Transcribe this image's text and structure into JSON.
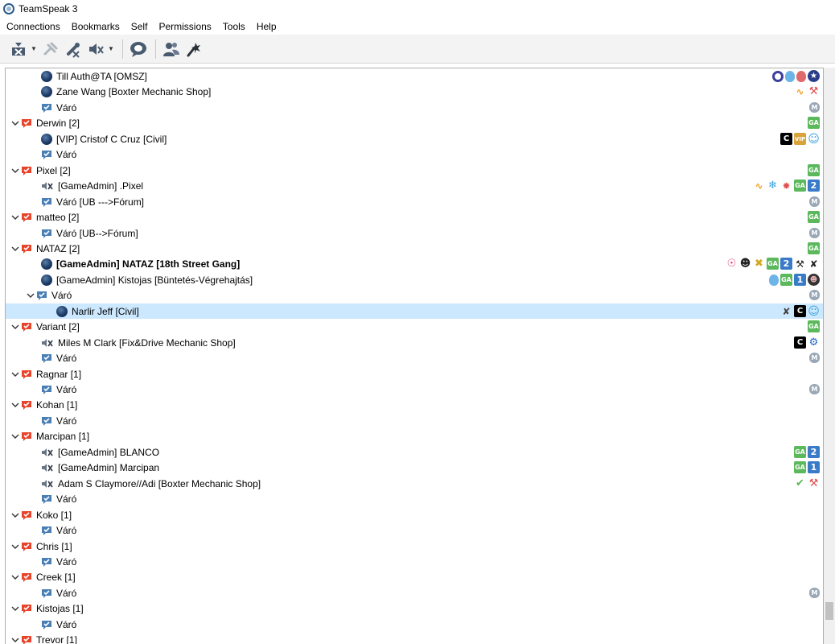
{
  "window": {
    "title": "TeamSpeak 3"
  },
  "menu": [
    "Connections",
    "Bookmarks",
    "Self",
    "Permissions",
    "Tools",
    "Help"
  ],
  "toolbar": [
    {
      "name": "disconnect",
      "icon": "disconnect-icon"
    },
    {
      "name": "connect",
      "icon": "link-icon"
    },
    {
      "name": "mute-microphone",
      "icon": "mic-mute-icon"
    },
    {
      "name": "mute-speakers",
      "icon": "speaker-mute-icon"
    },
    {
      "name": "away",
      "icon": "chat-bubble-icon"
    },
    {
      "name": "contacts",
      "icon": "users-icon"
    },
    {
      "name": "plugins",
      "icon": "wand-icon"
    }
  ],
  "tree": [
    {
      "level": 2,
      "type": "user",
      "label": "Till Auth@TA [OMSZ]",
      "right": [
        "ring-blue",
        "egg-blue",
        "egg-red",
        "star-badge"
      ]
    },
    {
      "level": 2,
      "type": "user",
      "label": "Zane Wang [Boxter Mechanic Shop]",
      "right": [
        "wave",
        "wrench"
      ]
    },
    {
      "level": 2,
      "type": "channel",
      "label": "Váró",
      "right": [
        "m"
      ]
    },
    {
      "level": 1,
      "type": "channel-group",
      "label": "Derwin [2]",
      "expanded": true,
      "right": [
        "ga"
      ]
    },
    {
      "level": 2,
      "type": "user",
      "label": "[VIP] Cristof C Cruz [Civil]",
      "right": [
        "c",
        "vip",
        "person"
      ]
    },
    {
      "level": 2,
      "type": "channel",
      "label": "Váró",
      "right": []
    },
    {
      "level": 1,
      "type": "channel-group",
      "label": "Pixel [2]",
      "expanded": true,
      "right": [
        "ga"
      ]
    },
    {
      "level": 2,
      "type": "user-muted",
      "label": "[GameAdmin] .Pixel",
      "right": [
        "wave",
        "snow",
        "burst",
        "ga",
        "num2"
      ]
    },
    {
      "level": 2,
      "type": "channel",
      "label": "Váró [UB --->Fórum]",
      "right": [
        "m"
      ]
    },
    {
      "level": 1,
      "type": "channel-group",
      "label": "matteo [2]",
      "expanded": true,
      "right": [
        "ga"
      ]
    },
    {
      "level": 2,
      "type": "channel",
      "label": "Váró [UB-->Fórum]",
      "right": [
        "m"
      ]
    },
    {
      "level": 1,
      "type": "channel-group",
      "label": "NATAZ [2]",
      "expanded": true,
      "right": [
        "ga"
      ]
    },
    {
      "level": 2,
      "type": "user",
      "label": "[GameAdmin] NATAZ [18th Street Gang]",
      "bold": true,
      "right": [
        "headset",
        "mask",
        "cross",
        "ga",
        "num2",
        "tool",
        "dancer"
      ]
    },
    {
      "level": 2,
      "type": "user",
      "label": "[GameAdmin] Kistojas [Büntetés-Végrehajtás]",
      "right": [
        "egg-blue",
        "ga",
        "num1",
        "angry"
      ]
    },
    {
      "level": 2,
      "type": "channel",
      "label": "Váró",
      "expanded": true,
      "right": [
        "m"
      ]
    },
    {
      "level": 3,
      "type": "user",
      "label": "Narlir Jeff [Civil]",
      "selected": true,
      "right": [
        "mic-cross",
        "c",
        "person"
      ]
    },
    {
      "level": 1,
      "type": "channel-group",
      "label": "Variant [2]",
      "expanded": true,
      "right": [
        "ga"
      ]
    },
    {
      "level": 2,
      "type": "user-muted",
      "label": "Miles M Clark [Fix&Drive Mechanic Shop]",
      "right": [
        "c",
        "gear"
      ]
    },
    {
      "level": 2,
      "type": "channel",
      "label": "Váró",
      "right": [
        "m"
      ]
    },
    {
      "level": 1,
      "type": "channel-group",
      "label": "Ragnar [1]",
      "expanded": true,
      "right": []
    },
    {
      "level": 2,
      "type": "channel",
      "label": "Váró",
      "right": [
        "m"
      ]
    },
    {
      "level": 1,
      "type": "channel-group",
      "label": "Kohan [1]",
      "expanded": true,
      "right": []
    },
    {
      "level": 2,
      "type": "channel",
      "label": "Váró",
      "right": []
    },
    {
      "level": 1,
      "type": "channel-group",
      "label": "Marcipan [1]",
      "expanded": true,
      "right": []
    },
    {
      "level": 2,
      "type": "user-muted",
      "label": "[GameAdmin] BLANCO",
      "right": [
        "ga",
        "num2"
      ]
    },
    {
      "level": 2,
      "type": "user-muted",
      "label": "[GameAdmin] Marcipan",
      "right": [
        "ga",
        "num1"
      ]
    },
    {
      "level": 2,
      "type": "user-muted",
      "label": "Adam S Claymore//Adi [Boxter Mechanic Shop]",
      "right": [
        "check",
        "wrench"
      ]
    },
    {
      "level": 2,
      "type": "channel",
      "label": "Váró",
      "right": []
    },
    {
      "level": 1,
      "type": "channel-group",
      "label": "Koko [1]",
      "expanded": true,
      "right": []
    },
    {
      "level": 2,
      "type": "channel",
      "label": "Váró",
      "right": []
    },
    {
      "level": 1,
      "type": "channel-group",
      "label": "Chris [1]",
      "expanded": true,
      "right": []
    },
    {
      "level": 2,
      "type": "channel",
      "label": "Váró",
      "right": []
    },
    {
      "level": 1,
      "type": "channel-group",
      "label": "Creek [1]",
      "expanded": true,
      "right": []
    },
    {
      "level": 2,
      "type": "channel",
      "label": "Váró",
      "right": [
        "m"
      ]
    },
    {
      "level": 1,
      "type": "channel-group",
      "label": "Kistojas [1]",
      "expanded": true,
      "right": []
    },
    {
      "level": 2,
      "type": "channel",
      "label": "Váró",
      "right": []
    },
    {
      "level": 1,
      "type": "channel-group",
      "label": "Trevor [1]",
      "expanded": true,
      "right": []
    }
  ],
  "badges": {
    "ga": "GA",
    "num1": "1",
    "num2": "2",
    "c": "C",
    "vip": "VIP",
    "m": "M"
  },
  "colors": {
    "selection": "#cce8ff",
    "channel_red": "#e8432b",
    "channel_blue": "#4a7fb5",
    "user_dot": "#1c3a66"
  }
}
